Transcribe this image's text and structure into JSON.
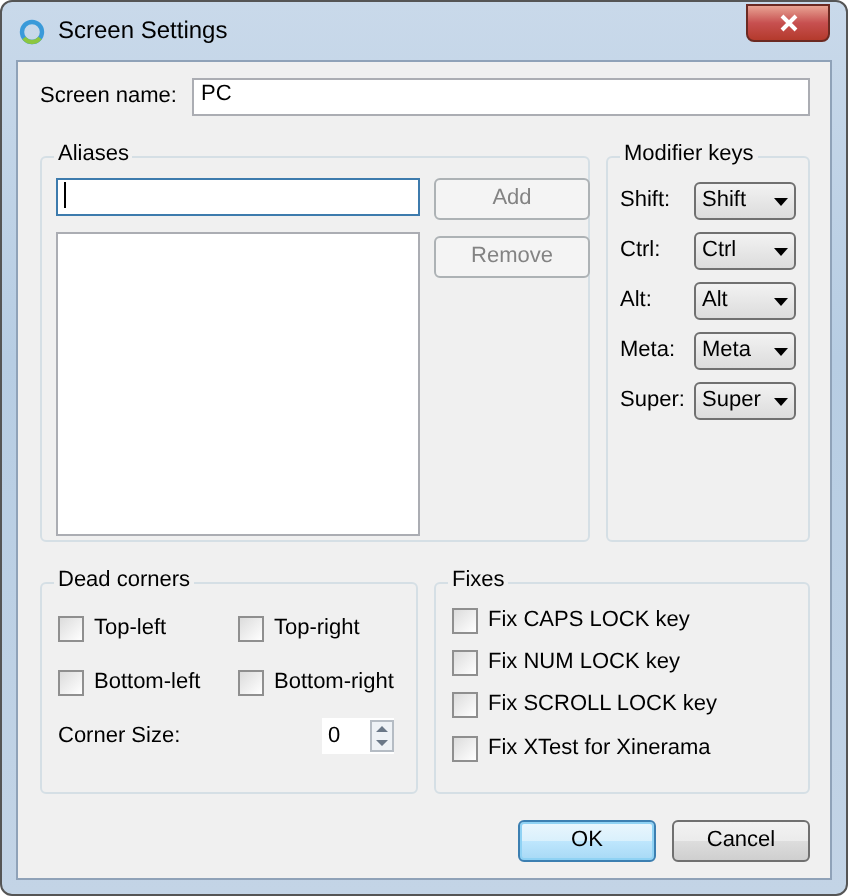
{
  "window": {
    "title": "Screen Settings"
  },
  "screen_name": {
    "label": "Screen name:",
    "value": "PC"
  },
  "aliases": {
    "title": "Aliases",
    "input_focused": true,
    "buttons": [
      {
        "label": "Add",
        "disabled": true
      },
      {
        "label": "Remove",
        "disabled": true
      }
    ]
  },
  "modifier_keys": {
    "title": "Modifier keys",
    "rows": [
      {
        "label": "Shift:",
        "value": "Shift"
      },
      {
        "label": "Ctrl:",
        "value": "Ctrl"
      },
      {
        "label": "Alt:",
        "value": "Alt"
      },
      {
        "label": "Meta:",
        "value": "Meta"
      },
      {
        "label": "Super:",
        "value": "Super"
      }
    ]
  },
  "dead_corners": {
    "title": "Dead corners",
    "corners": [
      {
        "label": "Top-left",
        "checked": false
      },
      {
        "label": "Top-right",
        "checked": false
      },
      {
        "label": "Bottom-left",
        "checked": false
      },
      {
        "label": "Bottom-right",
        "checked": false
      }
    ],
    "corner_size": {
      "label": "Corner Size:",
      "value": "0"
    }
  },
  "fixes": {
    "title": "Fixes",
    "items": [
      {
        "label": "Fix CAPS LOCK key",
        "checked": false
      },
      {
        "label": "Fix NUM LOCK key",
        "checked": false
      },
      {
        "label": "Fix SCROLL LOCK key",
        "checked": false
      },
      {
        "label": "Fix XTest for Xinerama",
        "checked": false
      }
    ]
  },
  "dialog_buttons": [
    {
      "label": "OK",
      "default": true
    },
    {
      "label": "Cancel",
      "default": false
    }
  ]
}
